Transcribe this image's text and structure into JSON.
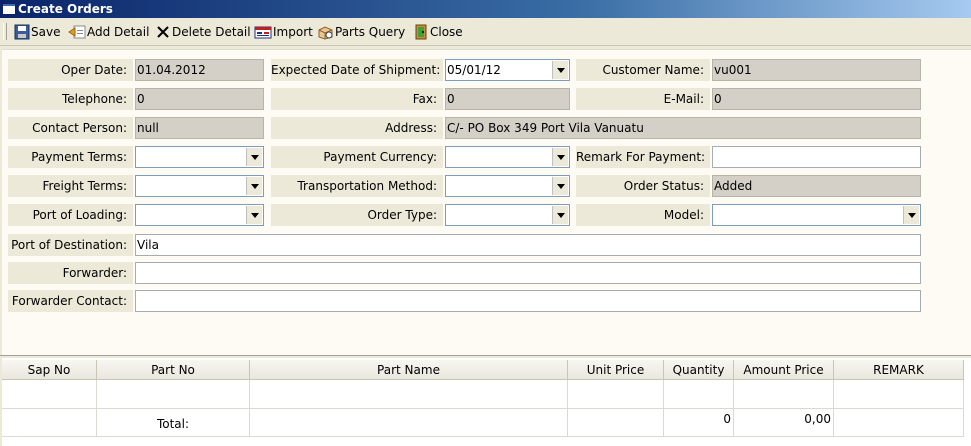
{
  "window": {
    "title": "Create Orders"
  },
  "toolbar": {
    "save": "Save",
    "add_detail": "Add Detail",
    "delete_detail": "Delete Detail",
    "import": "Import",
    "parts_query": "Parts Query",
    "close": "Close"
  },
  "form": {
    "oper_date": {
      "label": "Oper Date:",
      "value": "01.04.2012"
    },
    "expected_shipment": {
      "label": "Expected Date of Shipment:",
      "value": "05/01/12"
    },
    "customer_name": {
      "label": "Customer Name:",
      "value": "vu001"
    },
    "telephone": {
      "label": "Telephone:",
      "value": "0"
    },
    "fax": {
      "label": "Fax:",
      "value": "0"
    },
    "email": {
      "label": "E-Mail:",
      "value": "0"
    },
    "contact_person": {
      "label": "Contact Person:",
      "value": "null"
    },
    "address": {
      "label": "Address:",
      "value": "C/- PO Box 349 Port Vila Vanuatu"
    },
    "payment_terms": {
      "label": "Payment Terms:",
      "value": ""
    },
    "payment_currency": {
      "label": "Payment Currency:",
      "value": ""
    },
    "remark_payment": {
      "label": "Remark For Payment:",
      "value": ""
    },
    "freight_terms": {
      "label": "Freight Terms:",
      "value": ""
    },
    "transportation_method": {
      "label": "Transportation Method:",
      "value": ""
    },
    "order_status": {
      "label": "Order Status:",
      "value": "Added"
    },
    "port_loading": {
      "label": "Port of Loading:",
      "value": ""
    },
    "order_type": {
      "label": "Order Type:",
      "value": ""
    },
    "model": {
      "label": "Model:",
      "value": ""
    },
    "port_destination": {
      "label": "Port of Destination:",
      "value": "Vila"
    },
    "forwarder": {
      "label": "Forwarder:",
      "value": ""
    },
    "forwarder_contact": {
      "label": "Forwarder Contact:",
      "value": ""
    }
  },
  "grid": {
    "columns": [
      "Sap No",
      "Part No",
      "Part Name",
      "Unit Price",
      "Quantity",
      "Amount Price",
      "REMARK"
    ],
    "total_label": "Total:",
    "total_quantity": "0",
    "total_amount": "0,00"
  }
}
